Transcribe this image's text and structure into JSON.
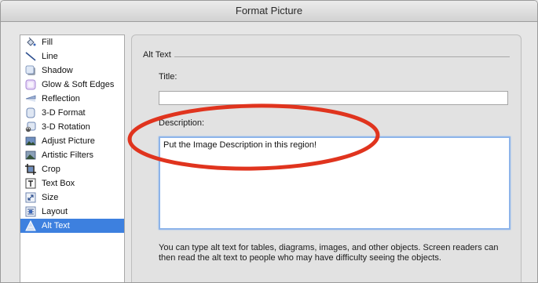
{
  "window": {
    "title": "Format Picture"
  },
  "sidebar": {
    "items": [
      {
        "label": "Fill",
        "icon": "fill-bucket-icon"
      },
      {
        "label": "Line",
        "icon": "line-icon"
      },
      {
        "label": "Shadow",
        "icon": "shadow-icon"
      },
      {
        "label": "Glow & Soft Edges",
        "icon": "glow-icon"
      },
      {
        "label": "Reflection",
        "icon": "reflection-icon"
      },
      {
        "label": "3-D Format",
        "icon": "3d-format-icon"
      },
      {
        "label": "3-D Rotation",
        "icon": "3d-rotation-icon"
      },
      {
        "label": "Adjust Picture",
        "icon": "adjust-picture-icon"
      },
      {
        "label": "Artistic Filters",
        "icon": "artistic-filters-icon"
      },
      {
        "label": "Crop",
        "icon": "crop-icon"
      },
      {
        "label": "Text Box",
        "icon": "text-box-icon"
      },
      {
        "label": "Size",
        "icon": "size-icon"
      },
      {
        "label": "Layout",
        "icon": "layout-icon"
      },
      {
        "label": "Alt Text",
        "icon": "alt-text-icon",
        "selected": true
      }
    ],
    "selected_color": "#3d80df"
  },
  "alt_text": {
    "section_label": "Alt Text",
    "title_label": "Title:",
    "title_value": "",
    "description_label": "Description:",
    "description_value": "Put the Image Description in this region!",
    "help_text": "You can type alt text for tables, diagrams, images, and other objects. Screen readers can then read the alt text to people who may have difficulty seeing the objects."
  },
  "annotation": {
    "color": "#e0341e"
  }
}
